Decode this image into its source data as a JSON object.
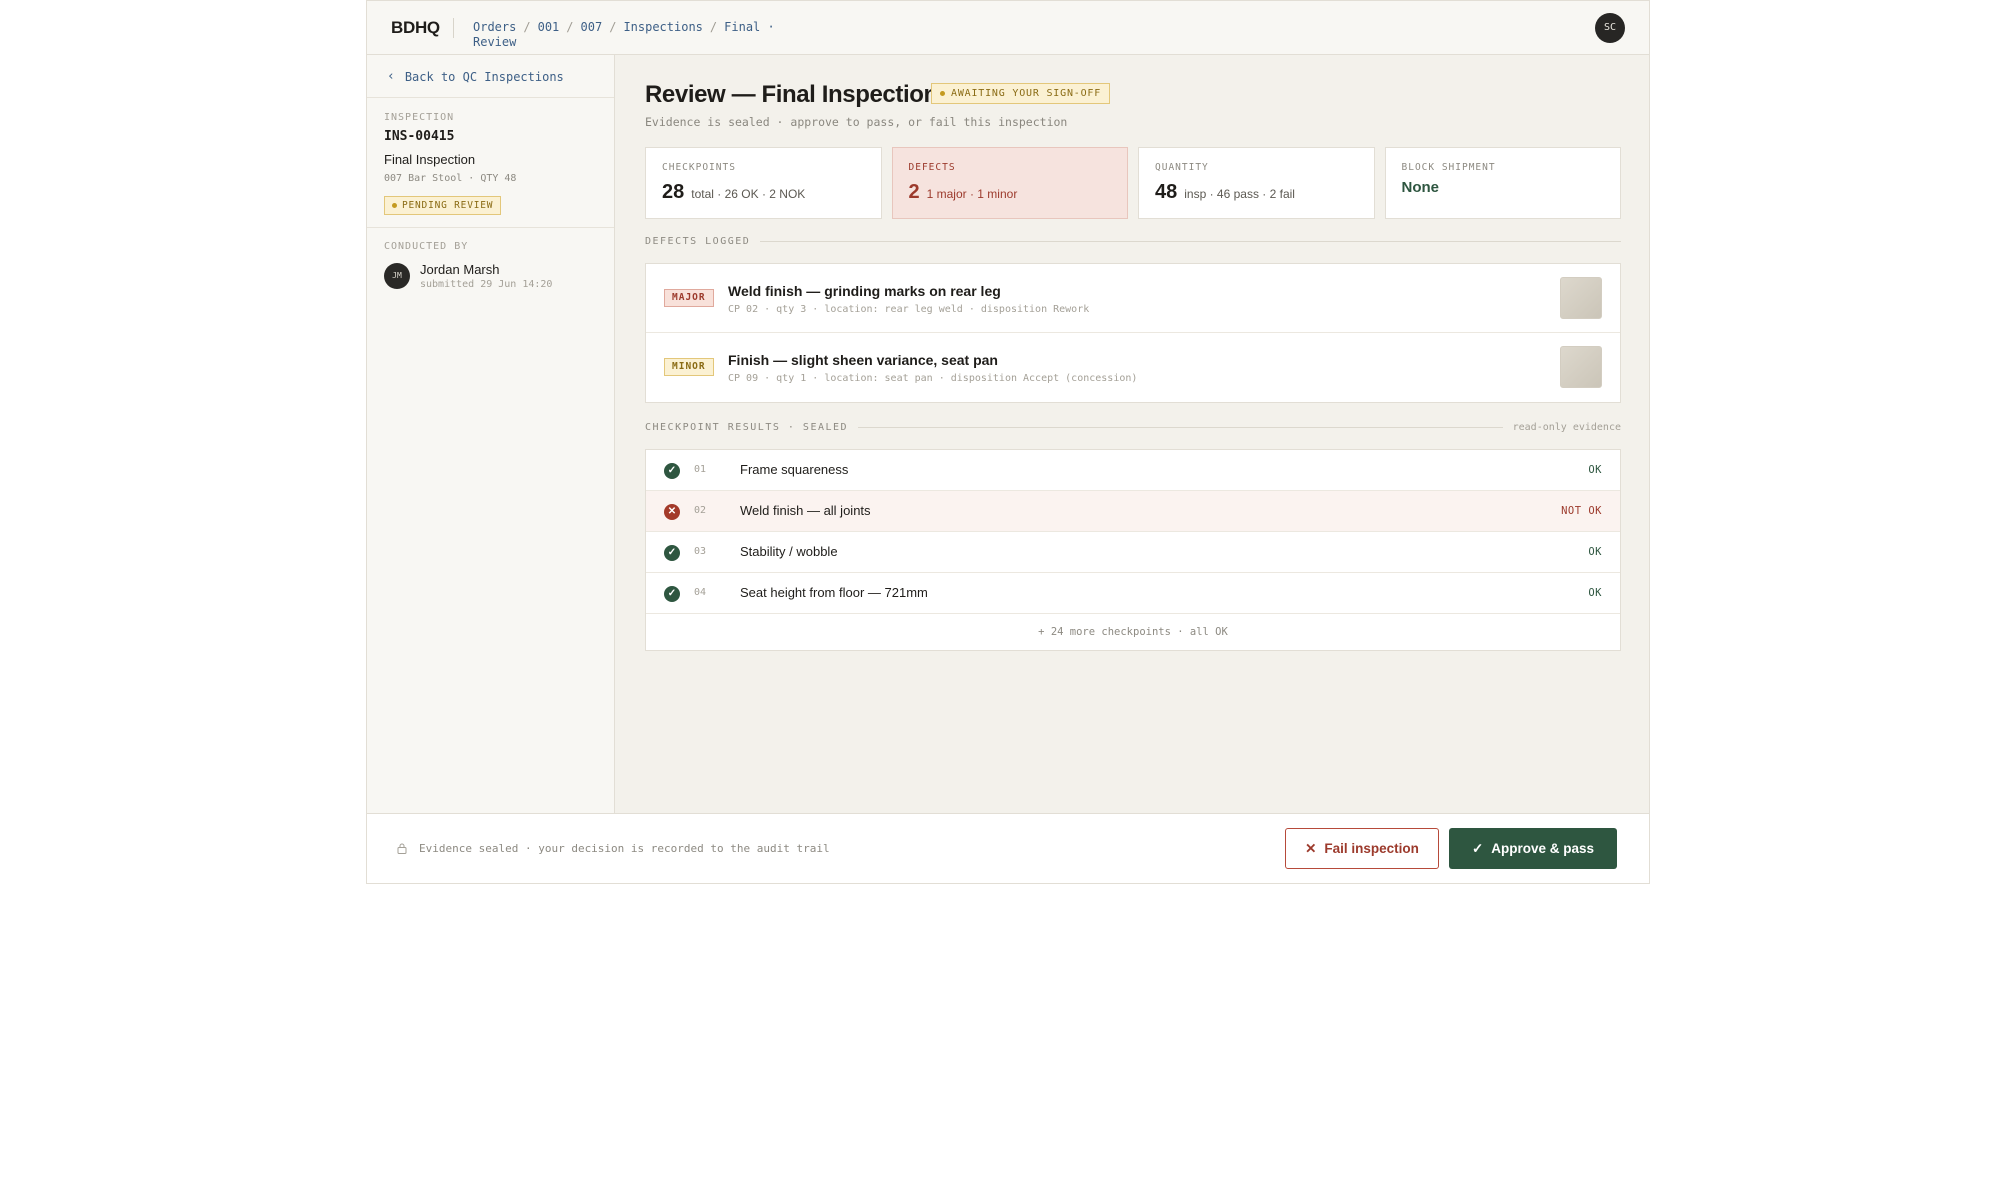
{
  "header": {
    "logo": "BDHQ",
    "breadcrumbs": [
      "Orders",
      "001",
      "007",
      "Inspections"
    ],
    "current_crumb": "Final · Review",
    "avatar_initials": "SC"
  },
  "sidebar": {
    "back_label": "Back to QC Inspections",
    "inspection_label": "INSPECTION",
    "inspection_id": "INS-00415",
    "inspection_name": "Final Inspection",
    "inspection_meta": "007 Bar Stool · QTY 48",
    "status_badge": "PENDING REVIEW",
    "conducted_label": "CONDUCTED BY",
    "conductor_initials": "JM",
    "conductor_name": "Jordan Marsh",
    "conductor_sub": "submitted 29 Jun 14:20"
  },
  "main": {
    "title": "Review — Final Inspection",
    "await_badge": "AWAITING YOUR SIGN-OFF",
    "subtitle": "Evidence is sealed · approve to pass, or fail this inspection",
    "stats": {
      "checkpoints": {
        "label": "CHECKPOINTS",
        "value": "28",
        "detail": "total · 26 OK · 2 NOK"
      },
      "defects": {
        "label": "DEFECTS",
        "value": "2",
        "detail": "1 major · 1 minor"
      },
      "quantity": {
        "label": "QUANTITY",
        "value": "48",
        "detail": "insp · 46 pass · 2 fail"
      },
      "block": {
        "label": "BLOCK SHIPMENT",
        "value": "None"
      }
    },
    "defects_heading": "DEFECTS LOGGED",
    "defects": [
      {
        "severity": "MAJOR",
        "title": "Weld finish — grinding marks on rear leg",
        "meta": "CP 02 · qty 3 · location: rear leg weld · disposition Rework"
      },
      {
        "severity": "MINOR",
        "title": "Finish — slight sheen variance, seat pan",
        "meta": "CP 09 · qty 1 · location: seat pan · disposition Accept (concession)"
      }
    ],
    "checkpoints_heading": "CHECKPOINT RESULTS · SEALED",
    "checkpoints_note": "read-only evidence",
    "checkpoints": [
      {
        "num": "01",
        "name": "Frame squareness",
        "status": "OK"
      },
      {
        "num": "02",
        "name": "Weld finish — all joints",
        "status": "NOT OK"
      },
      {
        "num": "03",
        "name": "Stability / wobble",
        "status": "OK"
      },
      {
        "num": "04",
        "name": "Seat height from floor — 721mm",
        "status": "OK"
      }
    ],
    "more_checkpoints": "+ 24 more checkpoints · all OK"
  },
  "footer": {
    "note": "Evidence sealed · your decision is recorded to the audit trail",
    "fail_label": "Fail inspection",
    "approve_label": "Approve & pass"
  },
  "colors": {
    "accent_green": "#2e5640",
    "danger_red": "#9c3a2c",
    "warning_amber": "#8a6b14",
    "link_blue": "#3d5f86"
  },
  "icons": [
    "chevron-left-icon",
    "lock-icon",
    "check-icon",
    "close-icon",
    "check-circle-icon",
    "x-circle-icon"
  ]
}
